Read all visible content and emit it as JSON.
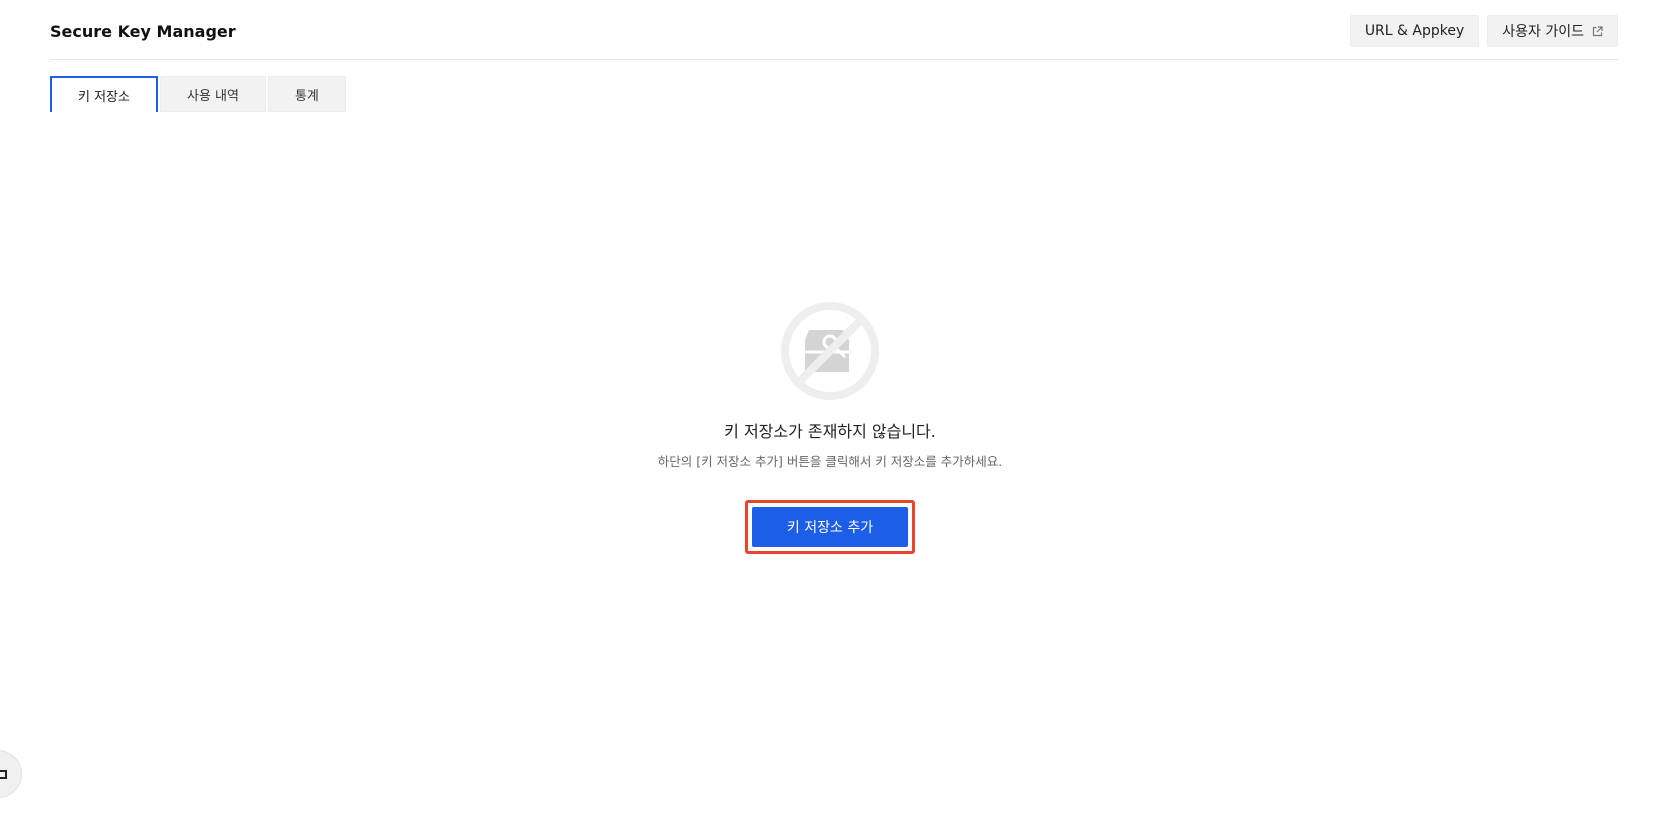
{
  "header": {
    "title": "Secure Key Manager",
    "url_appkey_label": "URL & Appkey",
    "user_guide_label": "사용자 가이드",
    "user_guide_icon": "external-link-icon"
  },
  "tabs": [
    {
      "label": "키 저장소",
      "active": true
    },
    {
      "label": "사용 내역",
      "active": false
    },
    {
      "label": "통계",
      "active": false
    }
  ],
  "empty_state": {
    "icon": "no-key-store-icon",
    "title": "키 저장소가 존재하지 않습니다.",
    "description": "하단의 [키 저장소 추가] 버튼을 클릭해서 키 저장소를 추가하세요.",
    "button_label": "키 저장소 추가"
  },
  "colors": {
    "accent": "#1c5ee8",
    "highlight": "#e8452c",
    "tab_background": "#f2f2f2"
  },
  "floating_button": {
    "icon": "square-icon"
  }
}
